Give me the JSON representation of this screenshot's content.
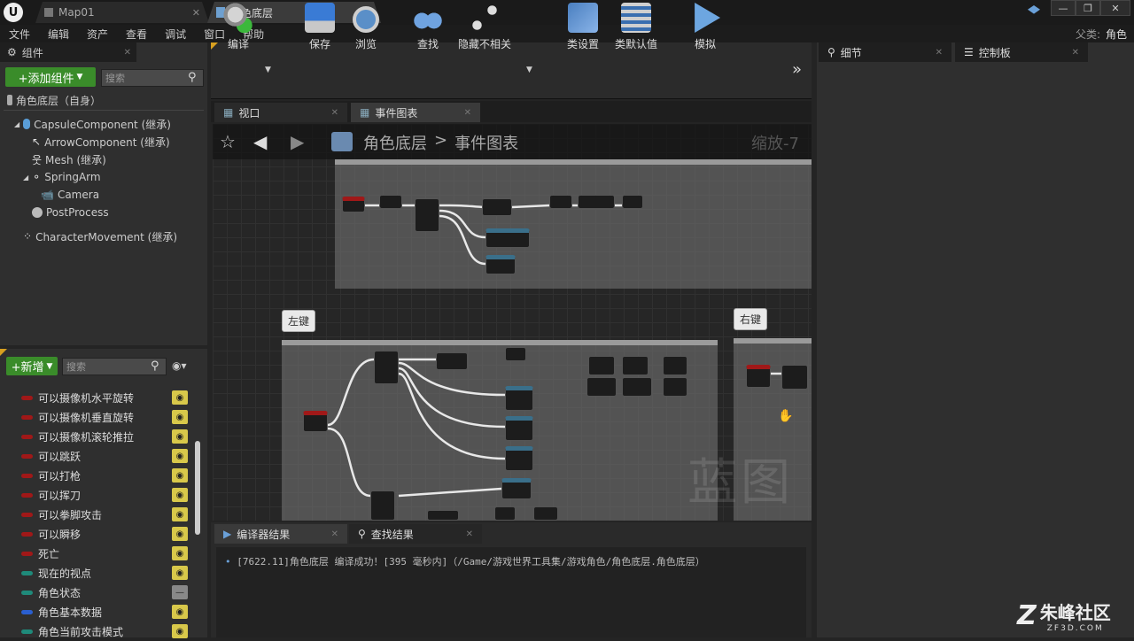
{
  "window": {
    "tabs": [
      {
        "label": "Map01"
      },
      {
        "label": "角色底层"
      }
    ],
    "min": "—",
    "max": "❐",
    "close": "✕"
  },
  "menubar": {
    "items": [
      "文件",
      "编辑",
      "资产",
      "查看",
      "调试",
      "窗口",
      "帮助"
    ],
    "parent_label": "父类:",
    "parent_value": "角色"
  },
  "components": {
    "title": "组件",
    "add_button": "+添加组件",
    "search_placeholder": "搜索",
    "self": "角色底层（自身）",
    "tree": [
      "CapsuleComponent (继承)",
      "ArrowComponent (继承)",
      "Mesh (继承)",
      "SpringArm",
      "Camera",
      "PostProcess",
      "CharacterMovement (继承)"
    ]
  },
  "mybp": {
    "new_button": "+新增",
    "search_placeholder": "搜索",
    "variables": [
      {
        "name": "可以摄像机水平旋转",
        "color": "#a01818",
        "visible": true
      },
      {
        "name": "可以摄像机垂直旋转",
        "color": "#a01818",
        "visible": true
      },
      {
        "name": "可以摄像机滚轮推拉",
        "color": "#a01818",
        "visible": true
      },
      {
        "name": "可以跳跃",
        "color": "#a01818",
        "visible": true
      },
      {
        "name": "可以打枪",
        "color": "#a01818",
        "visible": true
      },
      {
        "name": "可以挥刀",
        "color": "#a01818",
        "visible": true
      },
      {
        "name": "可以拳脚攻击",
        "color": "#a01818",
        "visible": true
      },
      {
        "name": "可以瞬移",
        "color": "#a01818",
        "visible": true
      },
      {
        "name": "死亡",
        "color": "#a01818",
        "visible": true
      },
      {
        "name": "现在的视点",
        "color": "#1f8a7a",
        "visible": true
      },
      {
        "name": "角色状态",
        "color": "#1f8a7a",
        "visible": false
      },
      {
        "name": "角色基本数据",
        "color": "#2a5fd0",
        "visible": true
      },
      {
        "name": "角色当前攻击模式",
        "color": "#1f8a7a",
        "visible": true
      }
    ]
  },
  "toolbar": {
    "buttons": [
      "编译",
      "保存",
      "浏览",
      "查找",
      "隐藏不相关",
      "类设置",
      "类默认值",
      "模拟"
    ]
  },
  "editor_tabs": {
    "viewport": "视口",
    "event_graph": "事件图表"
  },
  "graph": {
    "breadcrumb_root": "角色底层",
    "breadcrumb_sep": ">",
    "breadcrumb_leaf": "事件图表",
    "zoom": "缩放-7",
    "comment_left": "左键",
    "comment_right": "右键",
    "watermark": "蓝图"
  },
  "right_tabs": {
    "details": "细节",
    "control": "控制板"
  },
  "bottom": {
    "tab_compiler": "编译器结果",
    "tab_find": "查找结果",
    "log": "[7622.11]角色底层 编译成功！[395 毫秒内]（/Game/游戏世界工具集/游戏角色/角色底层.角色底层）"
  },
  "brand": {
    "name": "朱峰社区",
    "url": "ZF3D.COM"
  }
}
